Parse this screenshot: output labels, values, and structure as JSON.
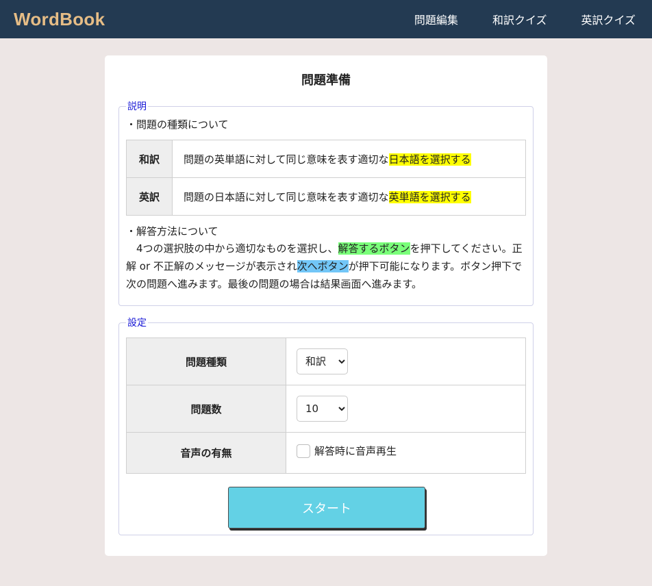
{
  "nav": {
    "brand": "WordBook",
    "links": [
      "問題編集",
      "和訳クイズ",
      "英訳クイズ"
    ]
  },
  "card": {
    "title": "問題準備"
  },
  "description": {
    "legend": "説明",
    "types_heading": "・問題の種類について",
    "types": [
      {
        "head": "和訳",
        "text": "問題の英単語に対して同じ意味を表す適切な",
        "highlight": "日本語を選択する"
      },
      {
        "head": "英訳",
        "text": "問題の日本語に対して同じ意味を表す適切な",
        "highlight": "英単語を選択する"
      }
    ],
    "method_heading": "・解答方法について",
    "method": {
      "part1": "4つの選択肢の中から適切なものを選択し、",
      "hl1": "解答するボタン",
      "part2": "を押下してください。正解 or 不正解のメッセージが表示され",
      "hl2": "次へボタン",
      "part3": "が押下可能になります。ボタン押下で次の問題へ進みます。最後の問題の場合は結果画面へ進みます。"
    }
  },
  "settings": {
    "legend": "設定",
    "question_type_label": "問題種類",
    "question_type_value": "和訳",
    "question_count_label": "問題数",
    "question_count_value": "10",
    "audio_label": "音声の有無",
    "audio_checkbox_label": "解答時に音声再生"
  },
  "start_button": "スタート",
  "colors": {
    "navbar": "#233a52",
    "brand": "#e6bd86",
    "background": "#ede6e5",
    "start_button": "#63d1e5",
    "legend": "#1a1ad6",
    "highlight_yellow": "#ffff00",
    "highlight_green": "#7aff7a",
    "highlight_blue": "#72c6f7"
  }
}
